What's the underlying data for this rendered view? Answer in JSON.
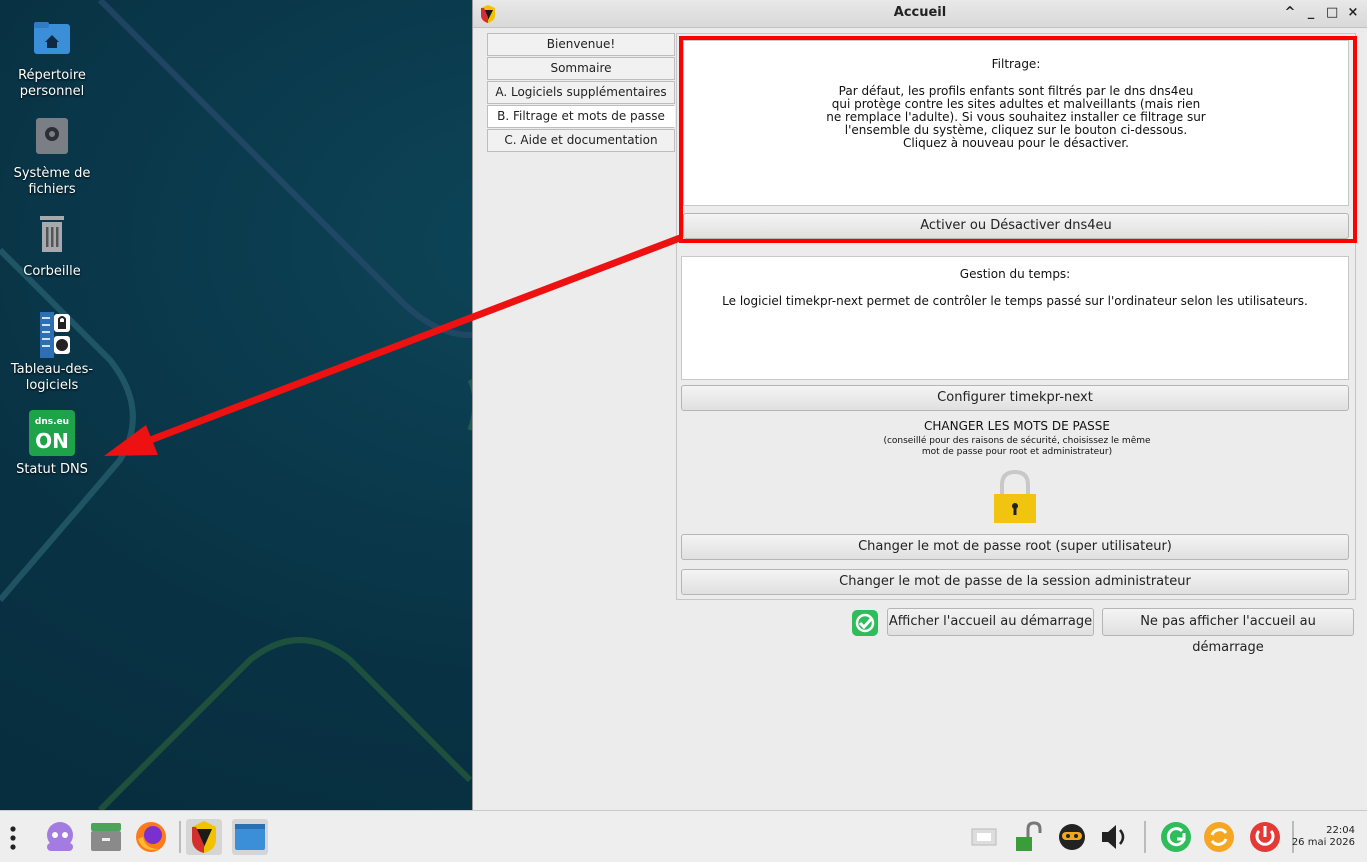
{
  "desktop": {
    "icons": [
      {
        "label": "Répertoire\npersonnel",
        "icon": "home-folder-icon"
      },
      {
        "label": "Système de\nfichiers",
        "icon": "drive-icon"
      },
      {
        "label": "Corbeille",
        "icon": "trash-icon"
      },
      {
        "label": "Tableau-des-\nlogiciels",
        "icon": "software-table-icon"
      },
      {
        "label": "Statut DNS",
        "icon": "dns-status-icon"
      }
    ],
    "dns_badge_top": "dns.eu",
    "dns_badge_bottom": "ON"
  },
  "window": {
    "title": "Accueil",
    "controls": [
      "^",
      "_",
      "□",
      "×"
    ]
  },
  "tabs": [
    {
      "label": "Bienvenue!"
    },
    {
      "label": "Sommaire"
    },
    {
      "label": "A. Logiciels supplémentaires"
    },
    {
      "label": "B. Filtrage et mots de passe",
      "active": true
    },
    {
      "label": "C. Aide et documentation"
    }
  ],
  "filtering": {
    "heading": "Filtrage:",
    "text": "Par défaut, les profils enfants sont filtrés par le dns dns4eu\nqui protège contre les sites adultes et malveillants (mais rien\nne remplace l'adulte). Si vous souhaitez installer ce filtrage sur\nl'ensemble du système, cliquez sur le bouton ci-dessous.\nCliquez à nouveau pour le désactiver.",
    "button": "Activer ou Désactiver dns4eu"
  },
  "time": {
    "heading": "Gestion du temps:",
    "text": "Le logiciel timekpr-next permet de contrôler le temps passé sur\nl'ordinateur selon les utilisateurs.",
    "button": "Configurer timekpr-next"
  },
  "passwords": {
    "heading": "CHANGER LES MOTS DE PASSE",
    "subtext": "(conseillé pour des raisons de sécurité, choisissez le même\nmot de passe pour root et administrateur)",
    "root_button": "Changer le mot de passe root (super utilisateur)",
    "admin_button": "Changer le mot de passe de la session administrateur"
  },
  "startup": {
    "show_button": "Afficher l'accueil au démarrage",
    "hide_button": "Ne pas afficher l'accueil au démarrage"
  },
  "taskbar": {
    "clock_time": "22:04",
    "clock_date": "26 mai 2026"
  },
  "colors": {
    "highlight": "#ff0000",
    "desktop_bg": "#083244",
    "dns_green": "#1fa34a",
    "lock_yellow": "#f1c40f"
  }
}
